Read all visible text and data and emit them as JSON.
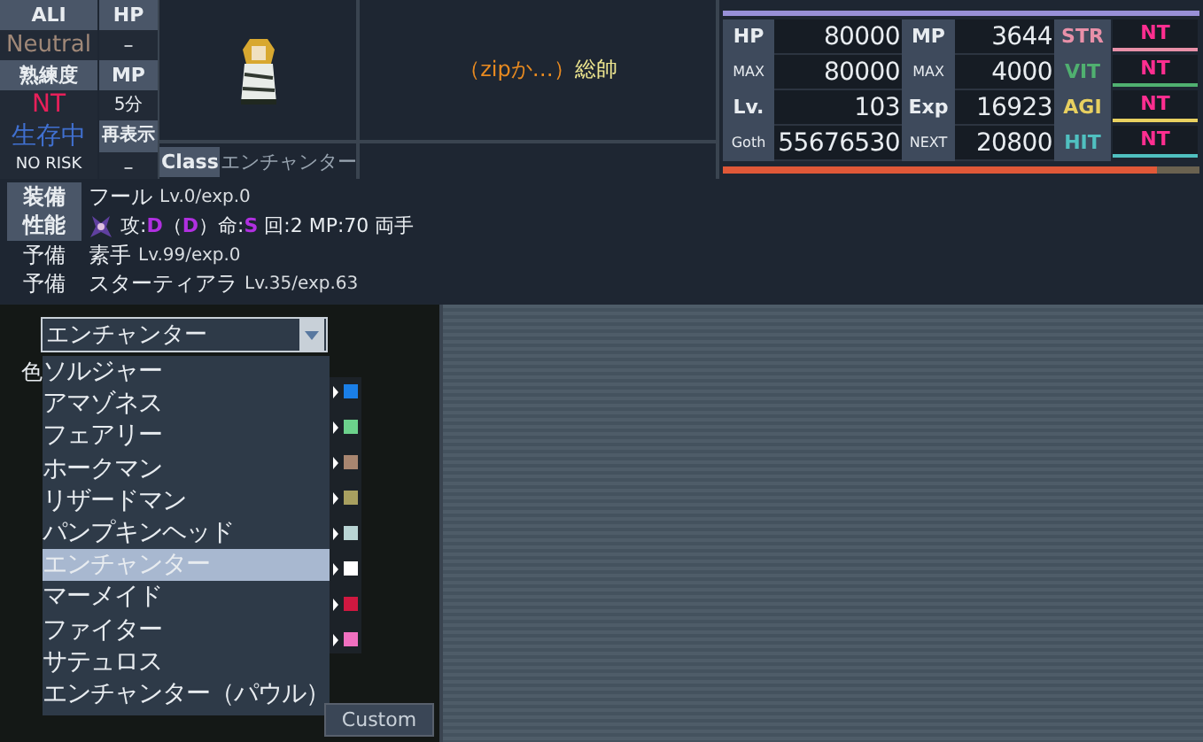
{
  "status": {
    "ali_label": "ALI",
    "hp_label": "HP",
    "alignment": "Neutral",
    "hp_value": "–",
    "skill_label": "熟練度",
    "mp_label": "MP",
    "skill_value": "NT",
    "mp_value": "5分",
    "life_state": "生存中",
    "redisplay": "再表示",
    "risk": "NO RISK",
    "redisplay_value": "–",
    "class_label": "Class",
    "class_value": "エンチャンター"
  },
  "title": {
    "prefix": "（zipか…）",
    "name": "総帥"
  },
  "stats": {
    "rows": [
      {
        "l1": "HP",
        "v1": "80000",
        "l2": "MP",
        "v2": "3644",
        "l3": "STR",
        "v3": "NT",
        "color": "#e890a8"
      },
      {
        "l1": "MAX",
        "v1": "80000",
        "l2": "MAX",
        "v2": "4000",
        "l3": "VIT",
        "v3": "NT",
        "color": "#50b070"
      },
      {
        "l1": "Lv.",
        "v1": "103",
        "l2": "Exp",
        "v2": "16923",
        "l3": "AGI",
        "v3": "NT",
        "color": "#e8d060"
      },
      {
        "l1": "Goth",
        "v1": "55676530",
        "l2": "NEXT",
        "v2": "20800",
        "l3": "HIT",
        "v3": "NT",
        "color": "#50c0c0"
      }
    ],
    "exp_bar": {
      "level": 0.91
    }
  },
  "equipment": [
    {
      "kind": "header",
      "label": "装備",
      "name": "フール",
      "detail": "Lv.0/exp.0"
    },
    {
      "kind": "perf",
      "label": "性能",
      "text": "攻:**D**（**D**）命:**S**  回:2  MP:70  両手"
    },
    {
      "kind": "plain",
      "label": "予備",
      "name": "素手",
      "detail": "Lv.99/exp.0"
    },
    {
      "kind": "plain",
      "label": "予備",
      "name": "スターティアラ",
      "detail": "Lv.35/exp.63"
    }
  ],
  "class_select": {
    "value": "エンチャンター",
    "color_label": "色",
    "options": [
      {
        "label": "ソルジャー",
        "selected": false
      },
      {
        "label": "アマゾネス",
        "selected": false
      },
      {
        "label": "フェアリー",
        "selected": false
      },
      {
        "label": "ホークマン",
        "selected": false
      },
      {
        "label": "リザードマン",
        "selected": false
      },
      {
        "label": "パンプキンヘッド",
        "selected": false
      },
      {
        "label": "エンチャンター",
        "selected": true
      },
      {
        "label": "マーメイド",
        "selected": false
      },
      {
        "label": "ファイター",
        "selected": false
      },
      {
        "label": "サテュロス",
        "selected": false
      },
      {
        "label": "エンチャンター（パウル）",
        "selected": false
      }
    ]
  },
  "colors": [
    {
      "color": "#1a7fe8"
    },
    {
      "color": "#6cd28c"
    },
    {
      "color": "#a88670"
    },
    {
      "color": "#a8a060"
    },
    {
      "color": "#b8d4d4"
    },
    {
      "color": "#ffffff"
    },
    {
      "color": "#d01840"
    },
    {
      "color": "#f070c0"
    }
  ],
  "custom_button": "Custom"
}
